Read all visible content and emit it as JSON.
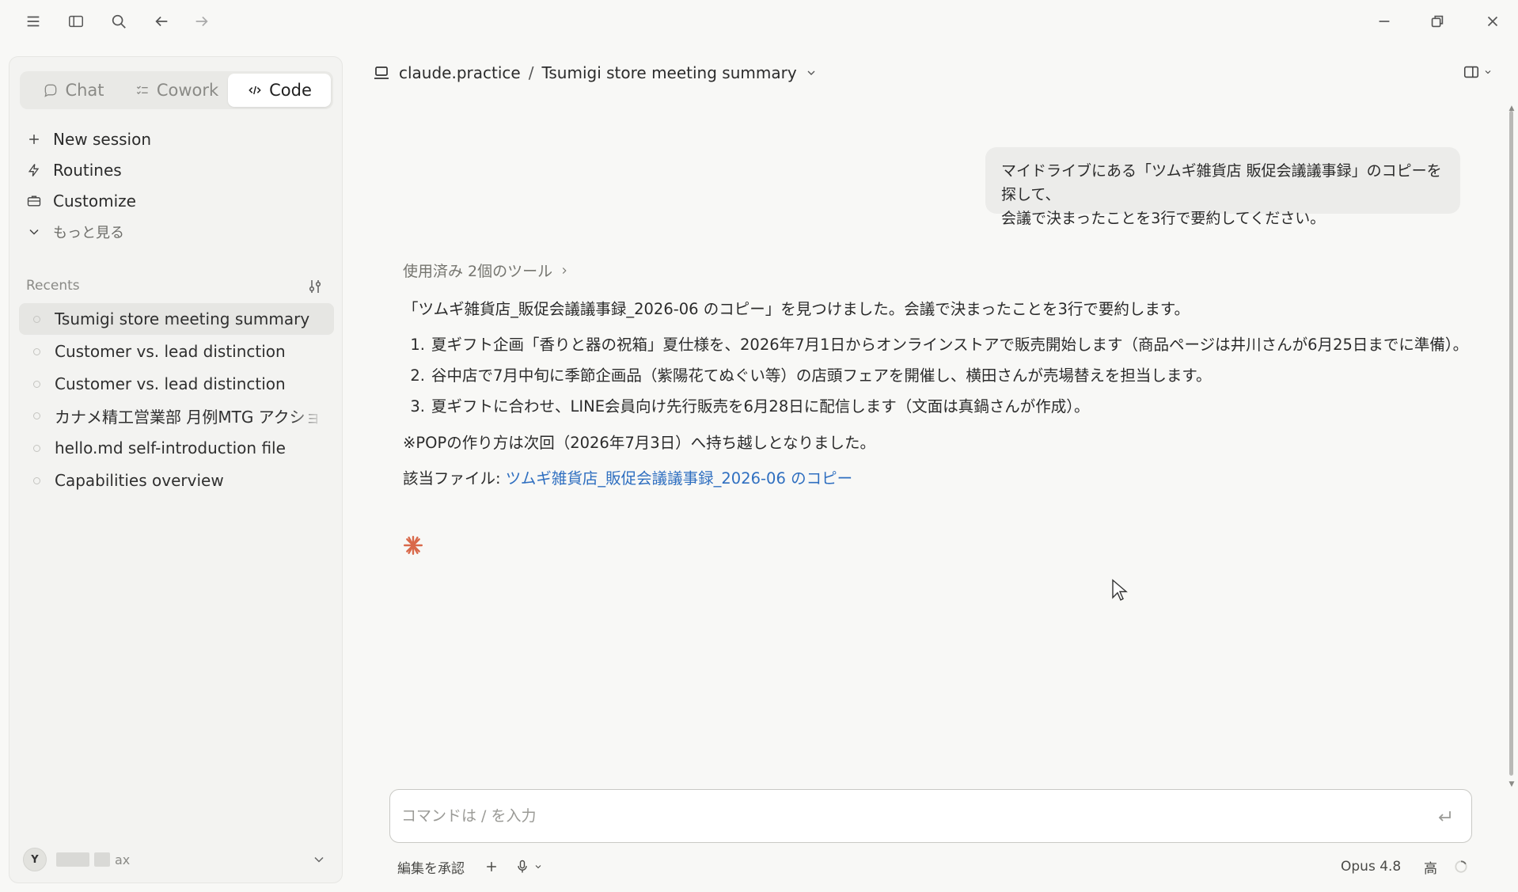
{
  "sidebar": {
    "tabs": [
      {
        "label": "Chat",
        "active": false
      },
      {
        "label": "Cowork",
        "active": false
      },
      {
        "label": "Code",
        "active": true
      }
    ],
    "nav": {
      "new_session": "New session",
      "routines": "Routines",
      "customize": "Customize",
      "more": "もっと見る"
    },
    "recents_label": "Recents",
    "recents": [
      "Tsumigi store meeting summary",
      "Customer vs. lead distinction",
      "Customer vs. lead distinction",
      "カナメ精工営業部 月例MTG アクション項目",
      "hello.md self-introduction file",
      "Capabilities overview"
    ],
    "user": {
      "initial": "Y",
      "name_suffix": "ax"
    }
  },
  "header": {
    "workspace": "claude.practice",
    "separator": "/",
    "session_title": "Tsumigi store meeting summary"
  },
  "conversation": {
    "user_message_line1": "マイドライブにある「ツムギ雑貨店 販促会議議事録」のコピーを探して、",
    "user_message_line2": "会議で決まったことを3行で要約してください。",
    "tools_used": "使用済み 2個のツール",
    "intro": "「ツムギ雑貨店_販促会議議事録_2026-06 のコピー」を見つけました。会議で決まったことを3行で要約します。",
    "summary": [
      {
        "num": "1.",
        "text": "夏ギフト企画「香りと器の祝箱」夏仕様を、2026年7月1日からオンラインストアで販売開始します（商品ページは井川さんが6月25日までに準備）。"
      },
      {
        "num": "2.",
        "text": "谷中店で7月中旬に季節企画品（紫陽花てぬぐい等）の店頭フェアを開催し、横田さんが売場替えを担当します。"
      },
      {
        "num": "3.",
        "text": "夏ギフトに合わせ、LINE会員向け先行販売を6月28日に配信します（文面は真鍋さんが作成）。"
      }
    ],
    "note": "※POPの作り方は次回（2026年7月3日）へ持ち越しとなりました。",
    "file_label": "該当ファイル: ",
    "file_link": "ツムギ雑貨店_販促会議議事録_2026-06 のコピー"
  },
  "composer": {
    "placeholder": "コマンドは / を入力"
  },
  "bottom_bar": {
    "approve_edits": "編集を承認",
    "model": "Opus 4.8",
    "effort": "高"
  },
  "colors": {
    "accent_spark": "#d9694a",
    "link": "#2f6fc0"
  }
}
